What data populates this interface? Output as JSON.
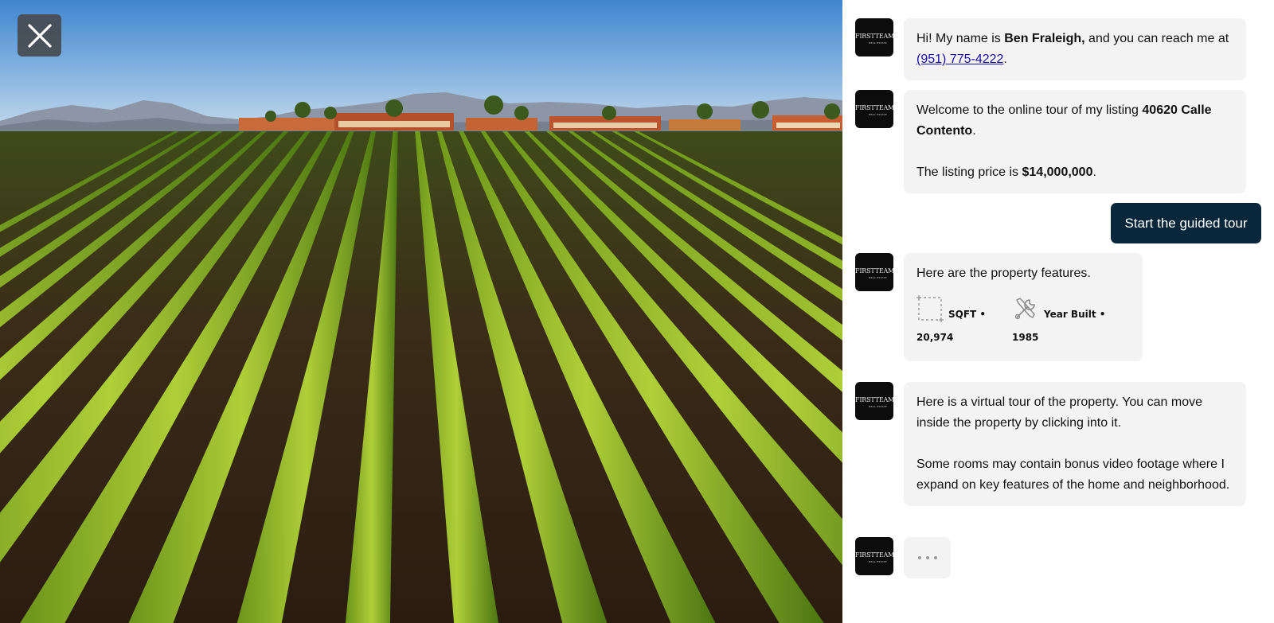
{
  "close_button": {
    "icon": "close-icon",
    "label": "Close"
  },
  "photo": {
    "subject": "vineyard-aerial-photo"
  },
  "chat": {
    "agent_logo": {
      "line1": "FIRSTTEAM",
      "line2": "REAL ESTATE"
    },
    "messages": [
      {
        "part1": "Hi! My name is ",
        "name": "Ben Fraleigh,",
        "part2": " and you can reach me at ",
        "phone": "(951) 775-4222",
        "part3": "."
      },
      {
        "part1": "Welcome to the online tour of my listing ",
        "address": "40620 Calle Contento",
        "part2": ".",
        "price_prefix": "The listing price is ",
        "price": "$14,000,000",
        "price_suffix": "."
      },
      {
        "text": "Here are the property features.",
        "features": [
          {
            "icon": "sqft-icon",
            "label": "SQFT •",
            "value": "20,974"
          },
          {
            "icon": "wrench-screwdriver-icon",
            "label": "Year Built •",
            "value": "1985"
          }
        ]
      },
      {
        "p1": "Here is a virtual tour of the property. You can move inside the property by clicking into it.",
        "p2": "Some rooms may contain bonus video footage where I expand on key features of the home and neighborhood."
      }
    ],
    "user_reply": "Start the guided tour",
    "typing_indicator": "..."
  }
}
